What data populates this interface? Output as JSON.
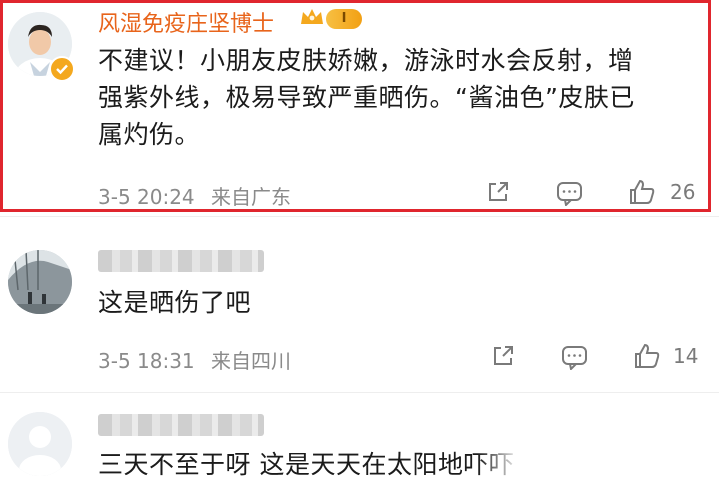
{
  "comments": [
    {
      "username": "风湿免疫庄坚博士",
      "badge": "I",
      "text_lines": [
        "不建议！小朋友皮肤娇嫩，游泳时水会反射，增",
        "强紫外线，极易导致严重晒伤。“酱油色”皮肤已",
        "属灼伤。"
      ],
      "time": "3-5 20:24",
      "location": "来自广东",
      "likes": "26"
    },
    {
      "text_lines": [
        "这是晒伤了吧"
      ],
      "time": "3-5 18:31",
      "location": "来自四川",
      "likes": "14"
    },
    {
      "text_lines": [
        "三天不至于呀 这是天天在太阳地吓吓"
      ]
    }
  ],
  "colors": {
    "username": "#e8641b",
    "highlight_border": "#e0262e",
    "badge": "#f4a81e",
    "meta": "#8a8a8a"
  },
  "icons": [
    "share-icon",
    "comment-icon",
    "like-icon",
    "verified-icon",
    "crown-icon"
  ]
}
